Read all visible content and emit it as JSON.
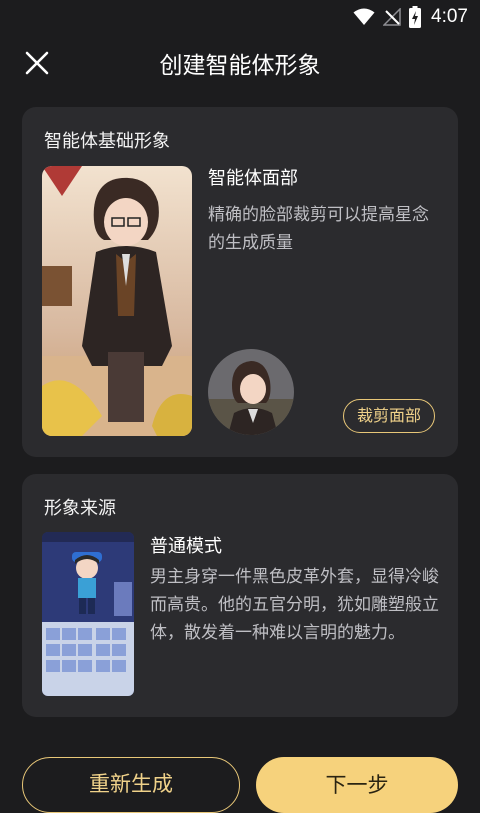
{
  "status_bar": {
    "time": "4:07",
    "icons": [
      "wifi-icon",
      "signal-off-icon",
      "battery-charging-icon"
    ]
  },
  "header": {
    "title": "创建智能体形象",
    "close_icon": "close-icon"
  },
  "base_section": {
    "title": "智能体基础形象",
    "face_title": "智能体面部",
    "face_desc": "精确的脸部裁剪可以提高星念的生成质量",
    "crop_button": "裁剪面部"
  },
  "source_section": {
    "title": "形象来源",
    "mode_title": "普通模式",
    "mode_desc": "男主身穿一件黑色皮革外套，显得冷峻而高贵。他的五官分明，犹如雕塑般立体，散发着一种难以言明的魅力。"
  },
  "footer": {
    "regenerate_label": "重新生成",
    "next_label": "下一步"
  },
  "colors": {
    "background": "#1c1c1e",
    "card": "#2b2b2e",
    "accent": "#f6d27c",
    "accent_border": "#e8c778"
  }
}
